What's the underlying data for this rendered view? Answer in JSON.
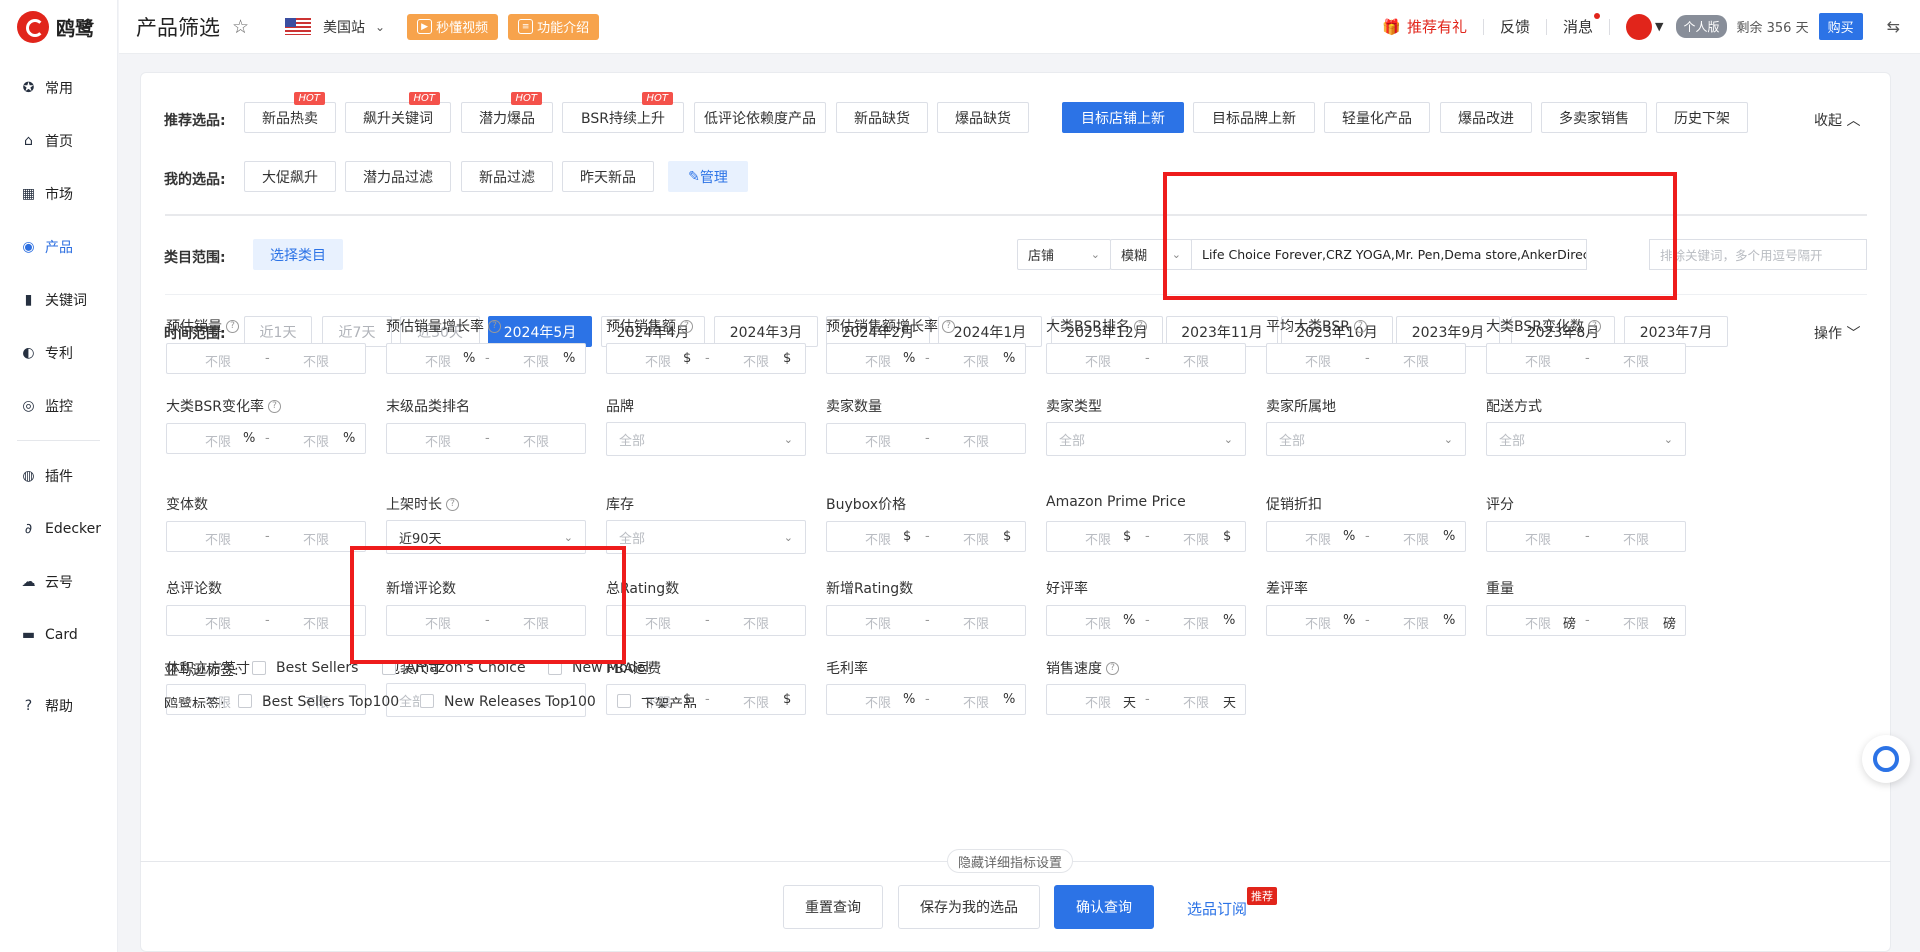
{
  "app": {
    "logo_text": "鸥鹭",
    "page_title": "产品筛选",
    "site": "美国站",
    "video_btn": "秒懂视频",
    "intro_btn": "功能介绍"
  },
  "topbar": {
    "gift": "推荐有礼",
    "feedback": "反馈",
    "messages": "消息",
    "plan": "个人版",
    "remain": "剩余 356 天",
    "buy": "购买"
  },
  "nav": [
    {
      "label": "常用",
      "icon": "star-circle-icon"
    },
    {
      "label": "首页",
      "icon": "home-icon"
    },
    {
      "label": "市场",
      "icon": "grid-icon"
    },
    {
      "label": "产品",
      "icon": "eye-icon"
    },
    {
      "label": "关键词",
      "icon": "bar-chart-icon"
    },
    {
      "label": "专利",
      "icon": "patent-icon"
    },
    {
      "label": "监控",
      "icon": "monitor-icon"
    },
    {
      "label": "插件",
      "icon": "chrome-icon"
    },
    {
      "label": "Edecker",
      "icon": "edecker-icon"
    },
    {
      "label": "云号",
      "icon": "cloud-icon"
    },
    {
      "label": "Card",
      "icon": "card-icon"
    },
    {
      "label": "帮助",
      "icon": "help-icon"
    }
  ],
  "recommend": {
    "label": "推荐选品:",
    "collapse": "收起",
    "hot": "HOT",
    "tags": [
      "新品热卖",
      "飙升关键词",
      "潜力爆品",
      "BSR持续上升",
      "低评论依赖度产品",
      "新品缺货",
      "爆品缺货",
      "目标店铺上新",
      "目标品牌上新",
      "轻量化产品",
      "爆品改进",
      "多卖家销售",
      "历史下架"
    ]
  },
  "mine": {
    "label": "我的选品:",
    "tags": [
      "大促飙升",
      "潜力品过滤",
      "新品过滤",
      "昨天新品"
    ],
    "manage": "管理"
  },
  "category": {
    "label": "类目范围:",
    "select": "选择类目",
    "store_sel": "店铺",
    "match_sel": "模糊",
    "keywords": "Life Choice Forever,CRZ YOGA,Mr. Pen,Dema store,AnkerDirect,iServ",
    "exclude_placeholder": "排除关键词，多个用逗号隔开"
  },
  "time": {
    "label": "时间范围:",
    "ops": "操作",
    "tags": [
      "近1天",
      "近7天",
      "近30天",
      "2024年5月",
      "2024年4月",
      "2024年3月",
      "2024年2月",
      "2024年1月",
      "2023年12月",
      "2023年11月",
      "2023年10月",
      "2023年9月",
      "2023年8月",
      "2023年7月"
    ]
  },
  "unlimited": "不限",
  "all": "全部",
  "filters": {
    "f1": "预估销量",
    "f2": "预估销量增长率",
    "f3": "预估销售额",
    "f4": "预估销售额增长率",
    "f5": "大类BSR排名",
    "f6": "平均大类BSR",
    "f7": "大类BSR变化数",
    "f8": "大类BSR变化率",
    "f9": "末级品类排名",
    "f10": "品牌",
    "f11": "卖家数量",
    "f12": "卖家类型",
    "f13": "卖家所属地",
    "f14": "配送方式",
    "f15": "变体数",
    "f16": "上架时长",
    "f17": "库存",
    "f18": "Buybox价格",
    "f19": "Amazon Prime Price",
    "f20": "促销折扣",
    "f21": "评分",
    "f22": "总评论数",
    "f23": "新增评论数",
    "f24": "总Rating数",
    "f25": "新增Rating数",
    "f26": "好评率",
    "f27": "差评率",
    "f28": "重量",
    "f29": "体积立方英寸",
    "f30": "包装尺寸",
    "f31": "FBA运费",
    "f32": "毛利率",
    "f33": "销售速度"
  },
  "listing_age_value": "近90天",
  "units": {
    "pct": "%",
    "usd": "$",
    "lb": "磅",
    "day": "天"
  },
  "amazon_tags": {
    "label": "亚马逊标签:",
    "items": [
      "Best Sellers",
      "Amazon's Choice",
      "New Model"
    ]
  },
  "oulu_tags": {
    "label": "鸥鹭标签:",
    "items": [
      "Best Sellers Top100",
      "New Releases Top100",
      "下架产品"
    ]
  },
  "toggle_detail": "隐藏详细指标设置",
  "footer": {
    "reset": "重置查询",
    "save": "保存为我的选品",
    "confirm": "确认查询",
    "subscribe": "选品订阅",
    "badge": "推荐"
  },
  "colors": {
    "primary": "#2c73e6",
    "brand_red": "#e1251b",
    "annotation_red": "#ee1c1c",
    "orange": "#f7a34c"
  }
}
